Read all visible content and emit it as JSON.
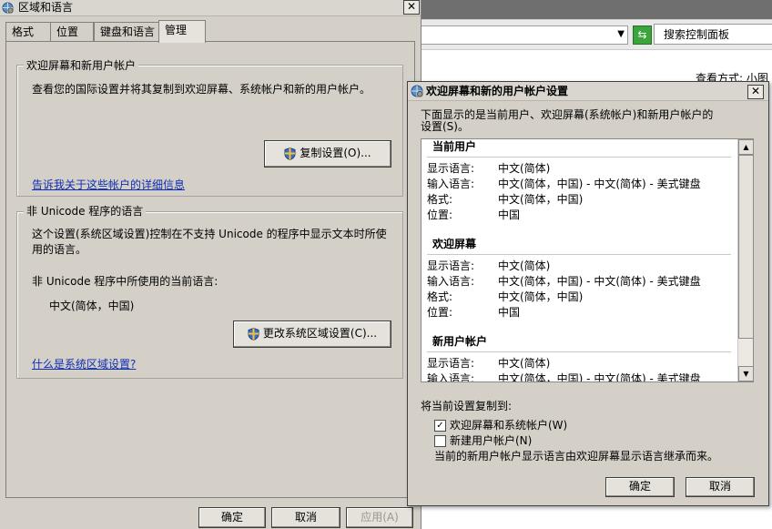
{
  "control_panel": {
    "search_placeholder": "搜索控制面板",
    "view_by": "查看方式: 小图"
  },
  "main_dialog": {
    "title": "区域和语言",
    "close": "✕",
    "tabs": [
      "格式",
      "位置",
      "键盘和语言",
      "管理"
    ],
    "active_tab": "管理",
    "welcome_group": {
      "title": "欢迎屏幕和新用户帐户",
      "description": "查看您的国际设置并将其复制到欢迎屏幕、系统帐户和新的用户帐户。",
      "copy_button": "复制设置(O)...",
      "link": "告诉我关于这些帐户的详细信息"
    },
    "unicode_group": {
      "title": "非 Unicode 程序的语言",
      "description": "这个设置(系统区域设置)控制在不支持 Unicode 的程序中显示文本时所使用的语言。",
      "current_label": "非 Unicode 程序中所使用的当前语言:",
      "current_value": "中文(简体，中国)",
      "change_button": "更改系统区域设置(C)...",
      "link": "什么是系统区域设置?"
    },
    "buttons": {
      "ok": "确定",
      "cancel": "取消",
      "apply": "应用(A)"
    }
  },
  "sub_dialog": {
    "title": "欢迎屏幕和新的用户帐户设置",
    "close": "✕",
    "intro_line1": "下面显示的是当前用户、欢迎屏幕(系统帐户)和新用户帐户的",
    "intro_line2": "设置(S)。",
    "sections": [
      {
        "heading": "当前用户",
        "rows": [
          {
            "key": "显示语言:",
            "value": "中文(简体)"
          },
          {
            "key": "输入语言:",
            "value": "中文(简体，中国) - 中文(简体) - 美式键盘"
          },
          {
            "key": "格式:",
            "value": "中文(简体，中国)"
          },
          {
            "key": "位置:",
            "value": "中国"
          }
        ]
      },
      {
        "heading": "欢迎屏幕",
        "rows": [
          {
            "key": "显示语言:",
            "value": "中文(简体)"
          },
          {
            "key": "输入语言:",
            "value": "中文(简体，中国) - 中文(简体) - 美式键盘"
          },
          {
            "key": "格式:",
            "value": "中文(简体，中国)"
          },
          {
            "key": "位置:",
            "value": "中国"
          }
        ]
      },
      {
        "heading": "新用户帐户",
        "rows": [
          {
            "key": "显示语言:",
            "value": "中文(简体)"
          },
          {
            "key": "输入语言:",
            "value": "中文(简体，中国) - 中文(简体) - 美式键盘"
          }
        ]
      }
    ],
    "copy_to_label": "将当前设置复制到:",
    "checkbox_welcome": {
      "label": "欢迎屏幕和系统帐户(W)",
      "checked": true
    },
    "checkbox_newuser": {
      "label": "新建用户帐户(N)",
      "checked": false
    },
    "note": "当前的新用户帐户显示语言由欢迎屏幕显示语言继承而来。",
    "buttons": {
      "ok": "确定",
      "cancel": "取消"
    }
  }
}
